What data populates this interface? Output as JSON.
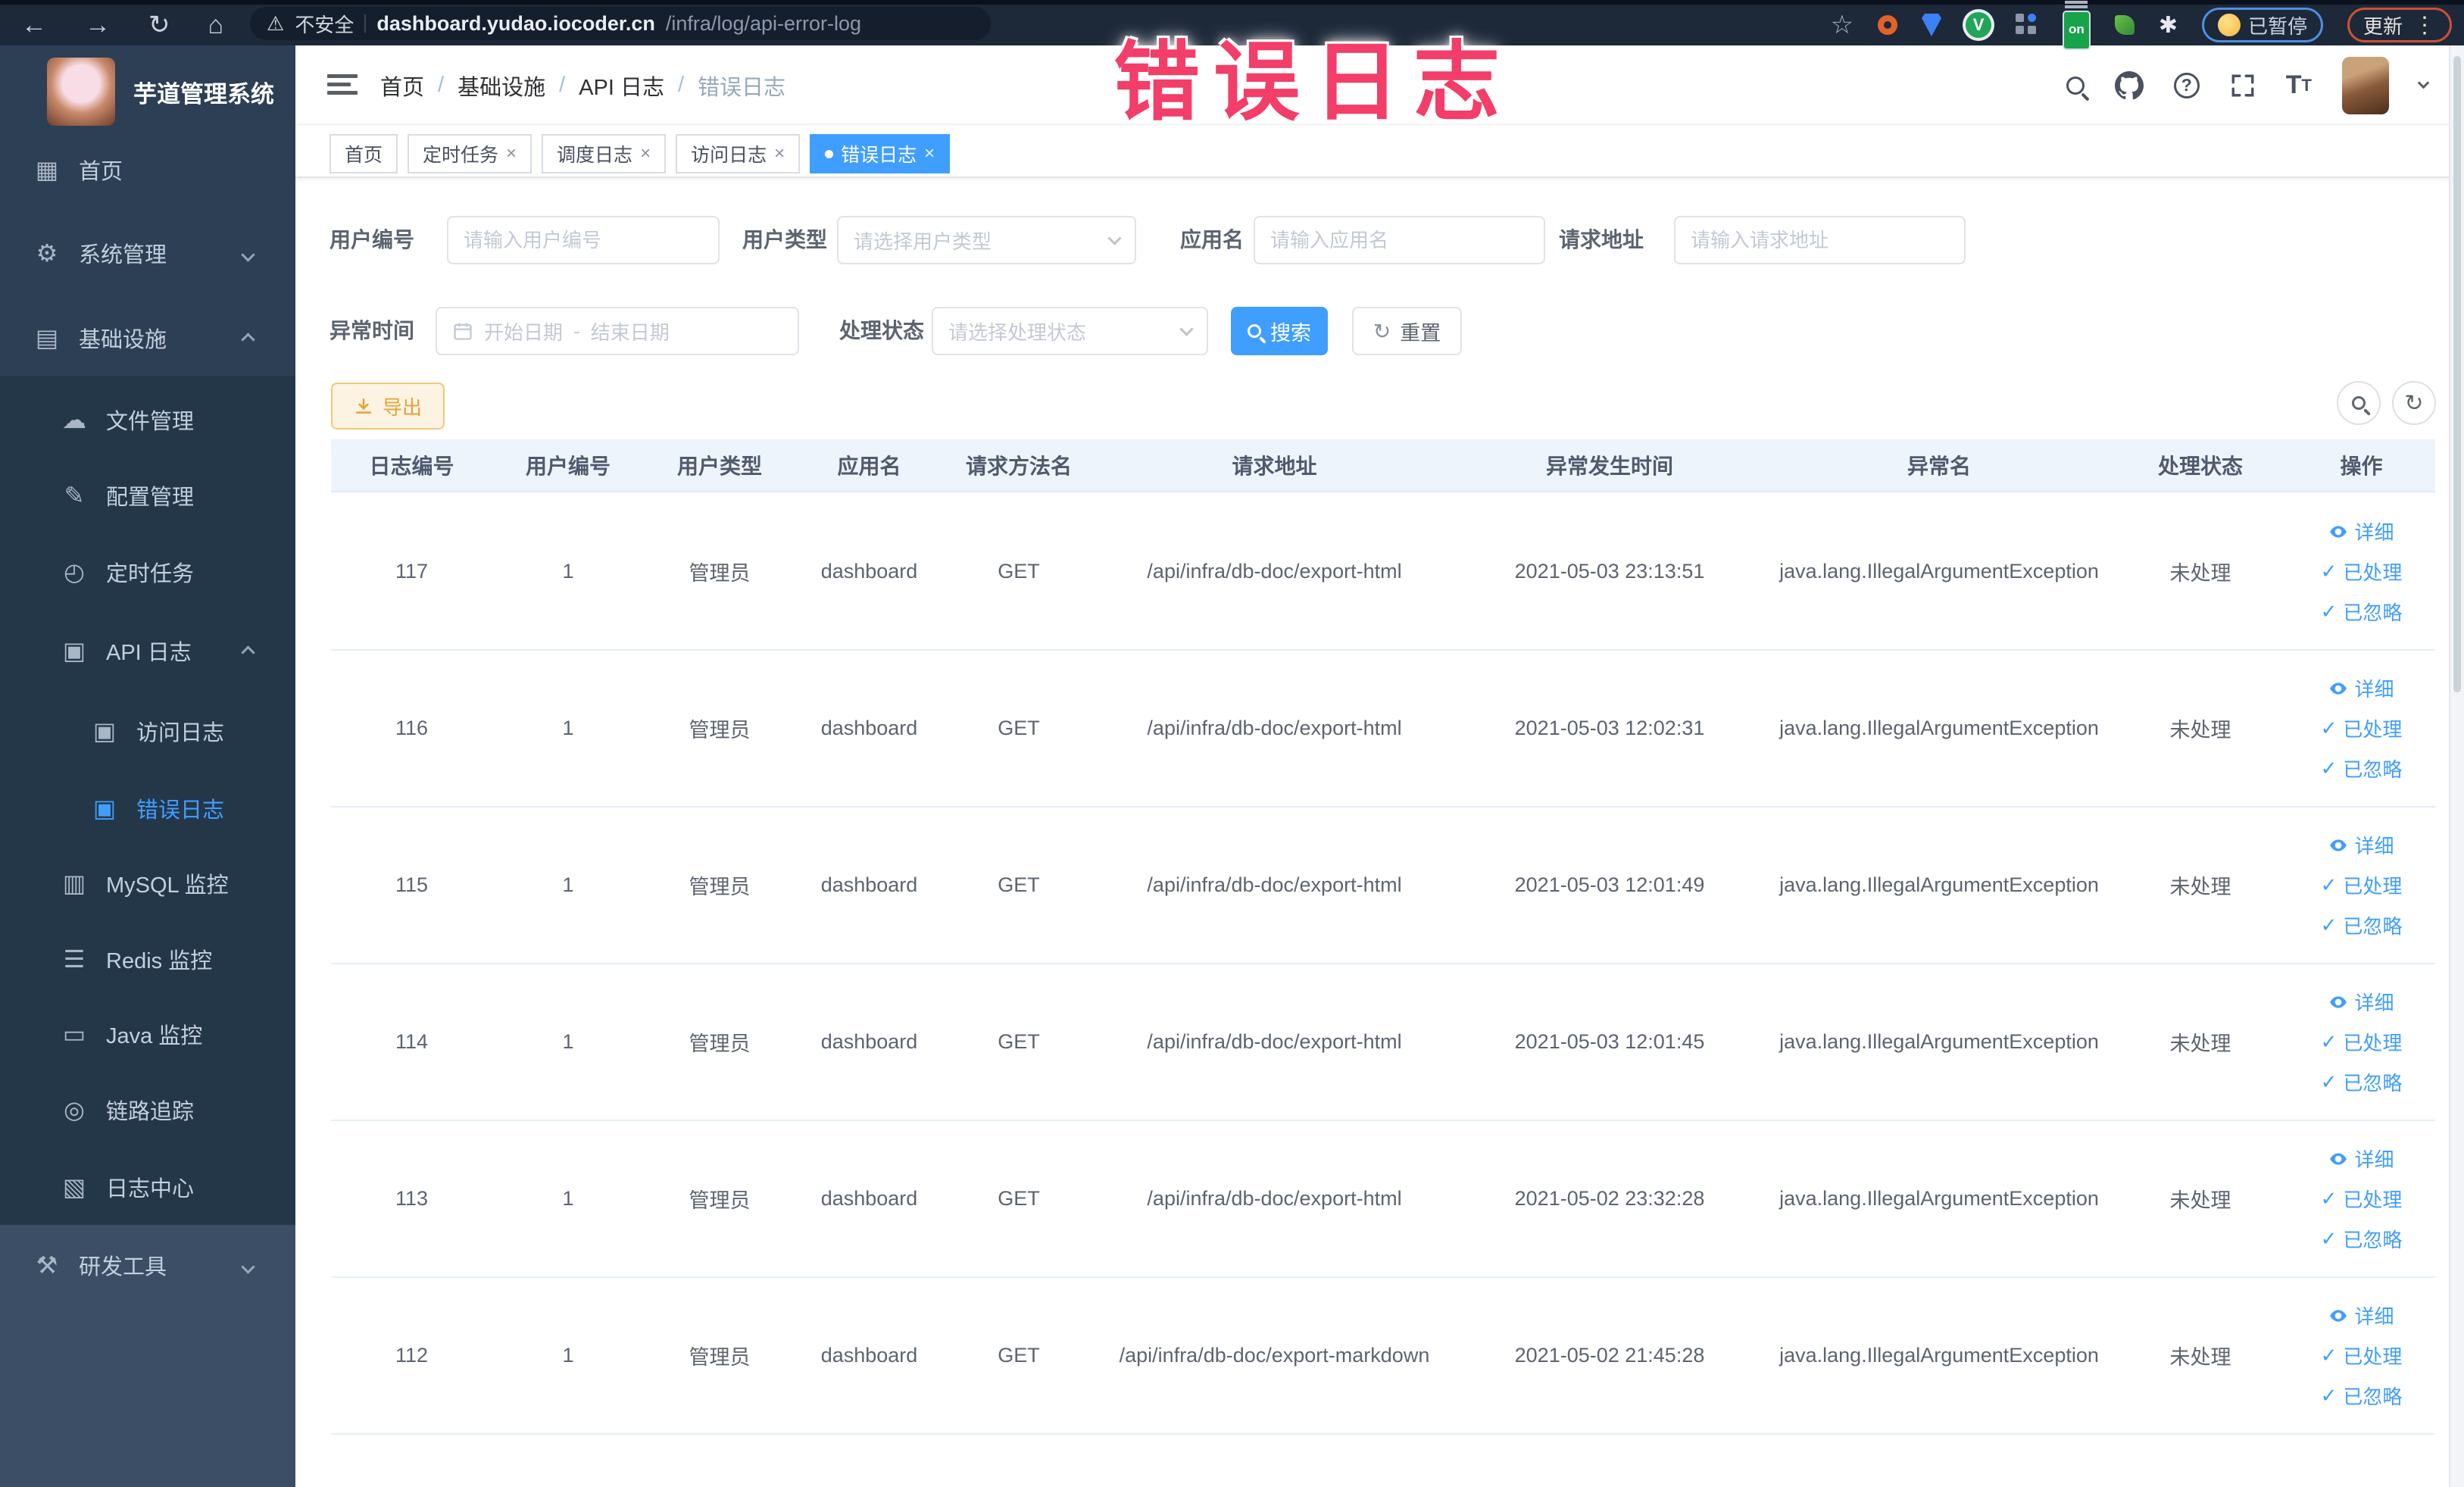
{
  "annotation": {
    "text": "错误日志"
  },
  "browser": {
    "security_label": "不安全",
    "url_host": "dashboard.yudao.iocoder.cn",
    "url_path": "/infra/log/api-error-log",
    "ext_on_badge": "on",
    "paused_label": "已暂停",
    "update_label": "更新"
  },
  "sidebar": {
    "title": "芋道管理系统",
    "items": [
      {
        "name": "home",
        "label": "首页",
        "level": 0,
        "icon": "dashboard-icon",
        "glyph": "▦",
        "arrow": "",
        "active": false
      },
      {
        "name": "system",
        "label": "系统管理",
        "level": 0,
        "icon": "gear-icon",
        "glyph": "⚙",
        "arrow": "down",
        "active": false
      },
      {
        "name": "infra",
        "label": "基础设施",
        "level": 0,
        "icon": "server-icon",
        "glyph": "▤",
        "arrow": "up",
        "active": false
      },
      {
        "name": "file",
        "label": "文件管理",
        "level": 1,
        "icon": "cloud-icon",
        "glyph": "☁",
        "arrow": "",
        "active": false
      },
      {
        "name": "config",
        "label": "配置管理",
        "level": 1,
        "icon": "edit-icon",
        "glyph": "✎",
        "arrow": "",
        "active": false
      },
      {
        "name": "job",
        "label": "定时任务",
        "level": 1,
        "icon": "timer-icon",
        "glyph": "◴",
        "arrow": "",
        "active": false
      },
      {
        "name": "api-log",
        "label": "API 日志",
        "level": 1,
        "icon": "log-icon",
        "glyph": "▣",
        "arrow": "up",
        "active": false
      },
      {
        "name": "access-log",
        "label": "访问日志",
        "level": 2,
        "icon": "log-icon",
        "glyph": "▣",
        "arrow": "",
        "active": false
      },
      {
        "name": "error-log",
        "label": "错误日志",
        "level": 2,
        "icon": "log-icon",
        "glyph": "▣",
        "arrow": "",
        "active": true
      },
      {
        "name": "mysql",
        "label": "MySQL 监控",
        "level": 1,
        "icon": "database-icon",
        "glyph": "▥",
        "arrow": "",
        "active": false
      },
      {
        "name": "redis",
        "label": "Redis 监控",
        "level": 1,
        "icon": "stack-icon",
        "glyph": "☰",
        "arrow": "",
        "active": false
      },
      {
        "name": "java",
        "label": "Java 监控",
        "level": 1,
        "icon": "monitor-icon",
        "glyph": "▭",
        "arrow": "",
        "active": false
      },
      {
        "name": "trace",
        "label": "链路追踪",
        "level": 1,
        "icon": "eye-icon",
        "glyph": "◎",
        "arrow": "",
        "active": false
      },
      {
        "name": "log-center",
        "label": "日志中心",
        "level": 1,
        "icon": "log-icon",
        "glyph": "▧",
        "arrow": "",
        "active": false
      },
      {
        "name": "dev-tools",
        "label": "研发工具",
        "level": 0,
        "icon": "toolbox-icon",
        "glyph": "⚒",
        "arrow": "down",
        "active": false
      }
    ]
  },
  "navbar": {
    "breadcrumb": [
      "首页",
      "基础设施",
      "API 日志",
      "错误日志"
    ]
  },
  "tabs": [
    {
      "label": "首页",
      "closable": false,
      "active": false
    },
    {
      "label": "定时任务",
      "closable": true,
      "active": false
    },
    {
      "label": "调度日志",
      "closable": true,
      "active": false
    },
    {
      "label": "访问日志",
      "closable": true,
      "active": false
    },
    {
      "label": "错误日志",
      "closable": true,
      "active": true
    }
  ],
  "filters": {
    "user_id": {
      "label": "用户编号",
      "placeholder": "请输入用户编号"
    },
    "user_type": {
      "label": "用户类型",
      "placeholder": "请选择用户类型"
    },
    "app_name": {
      "label": "应用名",
      "placeholder": "请输入应用名"
    },
    "request_url": {
      "label": "请求地址",
      "placeholder": "请输入请求地址"
    },
    "exception_time": {
      "label": "异常时间",
      "start_placeholder": "开始日期",
      "separator": "-",
      "end_placeholder": "结束日期"
    },
    "process_status": {
      "label": "处理状态",
      "placeholder": "请选择处理状态"
    },
    "search_label": "搜索",
    "reset_label": "重置"
  },
  "toolbar": {
    "export_label": "导出"
  },
  "table": {
    "headers": [
      "日志编号",
      "用户编号",
      "用户类型",
      "应用名",
      "请求方法名",
      "请求地址",
      "异常发生时间",
      "异常名",
      "处理状态",
      "操作"
    ],
    "actions": {
      "detail": "详细",
      "processed": "已处理",
      "ignored": "已忽略"
    },
    "rows": [
      {
        "id": "117",
        "user_id": "1",
        "user_type": "管理员",
        "app": "dashboard",
        "method": "GET",
        "url": "/api/infra/db-doc/export-html",
        "time": "2021-05-03 23:13:51",
        "exception": "java.lang.IllegalArgumentException",
        "status": "未处理"
      },
      {
        "id": "116",
        "user_id": "1",
        "user_type": "管理员",
        "app": "dashboard",
        "method": "GET",
        "url": "/api/infra/db-doc/export-html",
        "time": "2021-05-03 12:02:31",
        "exception": "java.lang.IllegalArgumentException",
        "status": "未处理"
      },
      {
        "id": "115",
        "user_id": "1",
        "user_type": "管理员",
        "app": "dashboard",
        "method": "GET",
        "url": "/api/infra/db-doc/export-html",
        "time": "2021-05-03 12:01:49",
        "exception": "java.lang.IllegalArgumentException",
        "status": "未处理"
      },
      {
        "id": "114",
        "user_id": "1",
        "user_type": "管理员",
        "app": "dashboard",
        "method": "GET",
        "url": "/api/infra/db-doc/export-html",
        "time": "2021-05-03 12:01:45",
        "exception": "java.lang.IllegalArgumentException",
        "status": "未处理"
      },
      {
        "id": "113",
        "user_id": "1",
        "user_type": "管理员",
        "app": "dashboard",
        "method": "GET",
        "url": "/api/infra/db-doc/export-html",
        "time": "2021-05-02 23:32:28",
        "exception": "java.lang.IllegalArgumentException",
        "status": "未处理"
      },
      {
        "id": "112",
        "user_id": "1",
        "user_type": "管理员",
        "app": "dashboard",
        "method": "GET",
        "url": "/api/infra/db-doc/export-markdown",
        "time": "2021-05-02 21:45:28",
        "exception": "java.lang.IllegalArgumentException",
        "status": "未处理"
      }
    ]
  },
  "colors": {
    "accent": "#409eff",
    "annotation": "#f23e68",
    "warning_text": "#e6a23c",
    "warning_bg": "#fdf3e3",
    "warning_border": "#f3c677",
    "sidebar_bg": "#2d3f55",
    "sidebar_submenu_bg": "#243749",
    "sidebar_bottom_bg": "#3b4e66",
    "browser_bar_bg": "#1d2838",
    "table_header_bg": "#edf4fc",
    "active_menu_text": "#409eff"
  }
}
